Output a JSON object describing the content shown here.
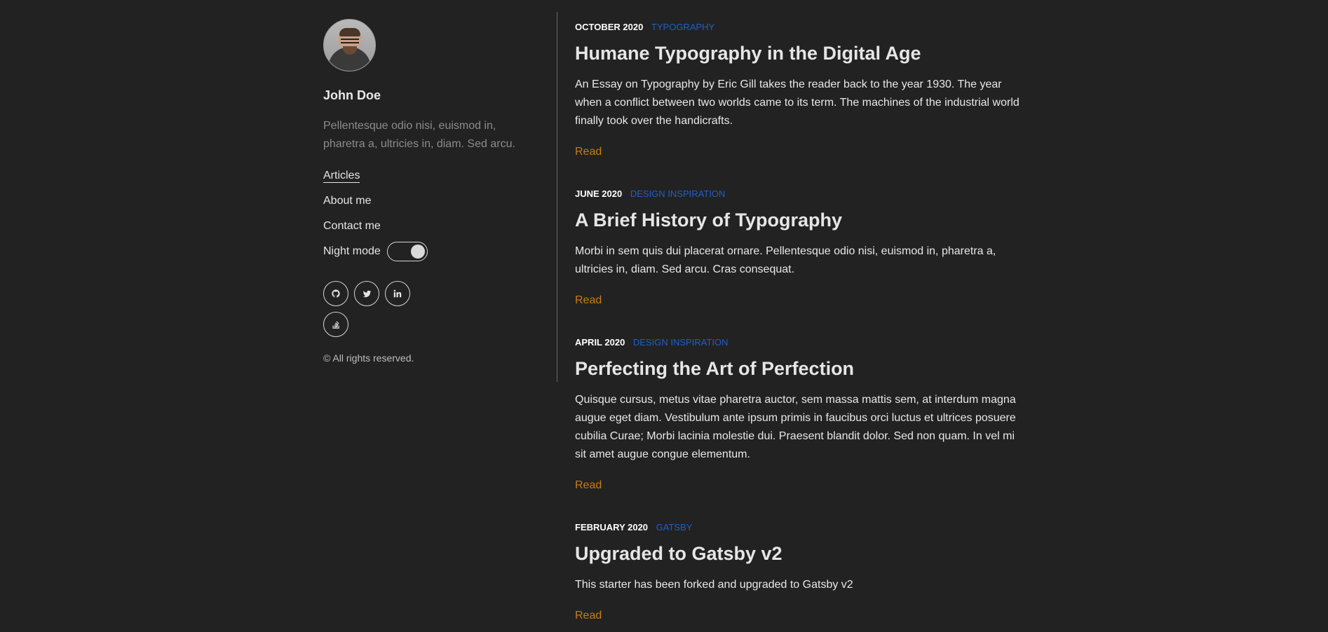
{
  "sidebar": {
    "author_name": "John Doe",
    "author_bio": "Pellentesque odio nisi, euismod in, pharetra a, ultricies in, diam. Sed arcu.",
    "nav": [
      {
        "label": "Articles",
        "active": true
      },
      {
        "label": "About me",
        "active": false
      },
      {
        "label": "Contact me",
        "active": false
      }
    ],
    "night_mode_label": "Night mode",
    "night_mode_on": true,
    "social": [
      {
        "icon": "github-icon"
      },
      {
        "icon": "twitter-icon"
      },
      {
        "icon": "linkedin-icon"
      },
      {
        "icon": "stackoverflow-icon"
      }
    ],
    "copyright": "© All rights reserved."
  },
  "articles": [
    {
      "date": "OCTOBER 2020",
      "category": "TYPOGRAPHY",
      "title": "Humane Typography in the Digital Age",
      "description": "An Essay on Typography by Eric Gill takes the reader back to the year 1930. The year when a conflict between two worlds came to its term. The machines of the industrial world finally took over the handicrafts.",
      "read_label": "Read"
    },
    {
      "date": "JUNE 2020",
      "category": "DESIGN INSPIRATION",
      "title": "A Brief History of Typography",
      "description": "Morbi in sem quis dui placerat ornare. Pellentesque odio nisi, euismod in, pharetra a, ultricies in, diam. Sed arcu. Cras consequat.",
      "read_label": "Read"
    },
    {
      "date": "APRIL 2020",
      "category": "DESIGN INSPIRATION",
      "title": "Perfecting the Art of Perfection",
      "description": "Quisque cursus, metus vitae pharetra auctor, sem massa mattis sem, at interdum magna augue eget diam. Vestibulum ante ipsum primis in faucibus orci luctus et ultrices posuere cubilia Curae; Morbi lacinia molestie dui. Praesent blandit dolor. Sed non quam. In vel mi sit amet augue congue elementum.",
      "read_label": "Read"
    },
    {
      "date": "FEBRUARY 2020",
      "category": "GATSBY",
      "title": "Upgraded to Gatsby v2",
      "description": "This starter has been forked and upgraded to Gatsby v2",
      "read_label": "Read"
    }
  ],
  "colors": {
    "background": "#222222",
    "category": "#1f5fc9",
    "read_link": "#c97c12",
    "text": "#e6e6e6"
  }
}
